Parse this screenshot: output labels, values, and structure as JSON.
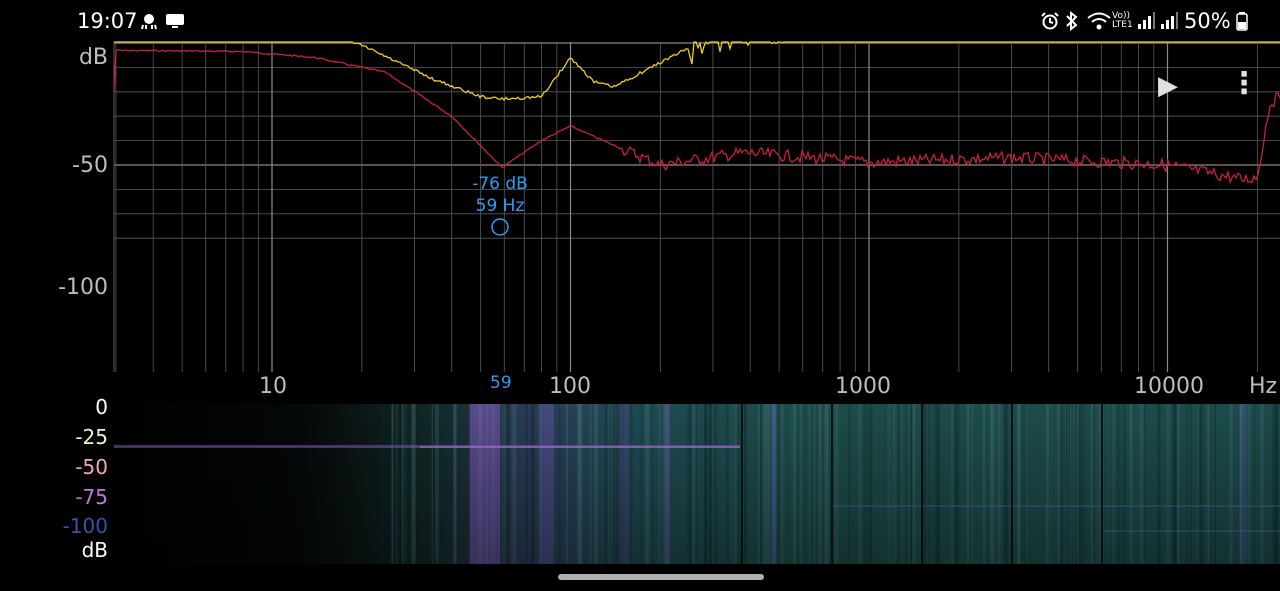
{
  "status_bar": {
    "time": "19:07",
    "left_icons": [
      "octopus-icon",
      "dex-icon"
    ],
    "dex_label": "DeX",
    "right_icons": [
      "alarm-icon",
      "bluetooth-icon",
      "wifi-icon",
      "volte-icon",
      "signal-icon",
      "signal-icon"
    ],
    "volte_label": "Vo)) LTE1",
    "battery": "50%"
  },
  "plot": {
    "y_unit": "dB",
    "y_ticks": [
      "-50",
      "-100"
    ],
    "x_unit": "Hz",
    "x_ticks": [
      "10",
      "100",
      "1000",
      "10000"
    ],
    "cursor": {
      "db": "-76 dB",
      "hz": "59 Hz",
      "x_marker": "59"
    },
    "colors": {
      "red_trace": "#c8203c",
      "yellow_trace": "#f0cc1e",
      "cursor": "#2a9df4",
      "grid": "#5a5a5a"
    }
  },
  "controls": {
    "play": "▶",
    "menu": "⋮"
  },
  "spectrogram": {
    "scale": [
      "0",
      "-25",
      "-50",
      "-75",
      "-100",
      "dB"
    ],
    "colors": [
      "#ffffff",
      "#f5f0c0",
      "#f0a8b8",
      "#c07ad8",
      "#3a4fb0",
      "#ffffff"
    ]
  }
}
